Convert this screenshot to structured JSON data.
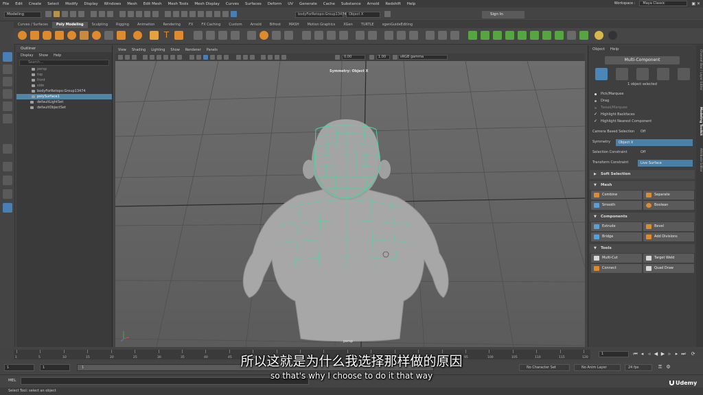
{
  "menubar": {
    "items": [
      "File",
      "Edit",
      "Create",
      "Select",
      "Modify",
      "Display",
      "Windows",
      "Mesh",
      "Edit Mesh",
      "Mesh Tools",
      "Mesh Display",
      "Curves",
      "Surfaces",
      "Deform",
      "UV",
      "Generate",
      "Cache",
      "Substance",
      "Arnold",
      "Redshift",
      "Help"
    ],
    "workspace_label": "Workspace :",
    "workspace_value": "Maya Classic"
  },
  "statusline": {
    "mode": "Modeling",
    "object_field": "bodyForRetopo:Group13474",
    "symmetry_field": "Object X",
    "sign_in": "Sign In"
  },
  "shelf": {
    "tabs": [
      "Curves / Surfaces",
      "Poly Modeling",
      "Sculpting",
      "Rigging",
      "Animation",
      "Rendering",
      "FX",
      "FX Caching",
      "Custom",
      "Arnold",
      "Bifrost",
      "MASH",
      "Motion Graphics",
      "XGen",
      "TURTLE",
      "xgenGuideEditing"
    ],
    "active_tab": "Poly Modeling"
  },
  "outliner": {
    "title": "Outliner",
    "menu": [
      "Display",
      "Show",
      "Help"
    ],
    "search_placeholder": "Search...",
    "rows": [
      {
        "label": "persp",
        "state": "dim"
      },
      {
        "label": "top",
        "state": "dim"
      },
      {
        "label": "front",
        "state": "dim"
      },
      {
        "label": "side",
        "state": "dim"
      },
      {
        "label": "bodyForRetopo:Group13474",
        "state": "normal"
      },
      {
        "label": "polySurface1",
        "state": "selected"
      },
      {
        "label": "defaultLightSet",
        "state": "normal"
      },
      {
        "label": "defaultObjectSet",
        "state": "normal"
      }
    ]
  },
  "viewport": {
    "menu": [
      "View",
      "Shading",
      "Lighting",
      "Show",
      "Renderer",
      "Panels"
    ],
    "exposure": "0.00",
    "gamma": "1.00",
    "color_space": "sRGB gamma",
    "symmetry_label": "Symmetry: Object X",
    "camera_label": "persp"
  },
  "modeling_toolkit": {
    "menu": [
      "Object",
      "Help"
    ],
    "header": "Multi-Component",
    "selection_status": "1 object selected",
    "options": [
      {
        "label": "Pick/Marquee",
        "type": "radio",
        "state": "on"
      },
      {
        "label": "Drag",
        "type": "radio",
        "state": "off"
      },
      {
        "label": "Tweak/Marquee",
        "type": "radio",
        "state": "disabled"
      },
      {
        "label": "Highlight Backfaces",
        "type": "check",
        "state": "on"
      },
      {
        "label": "Highlight Nearest Component",
        "type": "check",
        "state": "on"
      }
    ],
    "camera_based_label": "Camera Based Selection",
    "camera_based_value": "Off",
    "symmetry_label": "Symmetry",
    "symmetry_value": "Object X",
    "constraint_label": "Selection Constraint",
    "constraint_value": "Off",
    "transform_constraint_label": "Transform Constraint",
    "transform_constraint_value": "Live Surface",
    "soft_selection": "Soft Selection",
    "sections": {
      "mesh": {
        "title": "Mesh",
        "buttons": [
          "Combine",
          "Separate",
          "Smooth",
          "Boolean"
        ]
      },
      "components": {
        "title": "Components",
        "buttons": [
          "Extrude",
          "Bevel",
          "Bridge",
          "Add Divisions"
        ]
      },
      "tools": {
        "title": "Tools",
        "buttons": [
          "Multi-Cut",
          "Target Weld",
          "Connect",
          "Quad Draw"
        ]
      }
    },
    "side_tabs": [
      "Channel Box / Layer Editor",
      "Modeling Toolkit",
      "Attribute Editor"
    ]
  },
  "timeslider": {
    "ticks": [
      "1",
      "5",
      "10",
      "15",
      "20",
      "25",
      "30",
      "35",
      "40",
      "45",
      "50",
      "55",
      "60",
      "65",
      "70",
      "75",
      "80",
      "85",
      "90",
      "95",
      "100",
      "105",
      "110",
      "115",
      "120"
    ],
    "current_frame": "1"
  },
  "rangebar": {
    "start": "1",
    "start2": "1",
    "slider_value": "1",
    "character_set": "No Character Set",
    "anim_layer": "No Anim Layer",
    "fps": "24 fps"
  },
  "cmdline": {
    "label": "MEL"
  },
  "helpline": {
    "text": "Select Tool: select an object"
  },
  "subtitles": {
    "chinese": "所以这就是为什么我选择那样做的原因",
    "english": "so that's why I choose to do it that way"
  },
  "watermark": "Udemy"
}
